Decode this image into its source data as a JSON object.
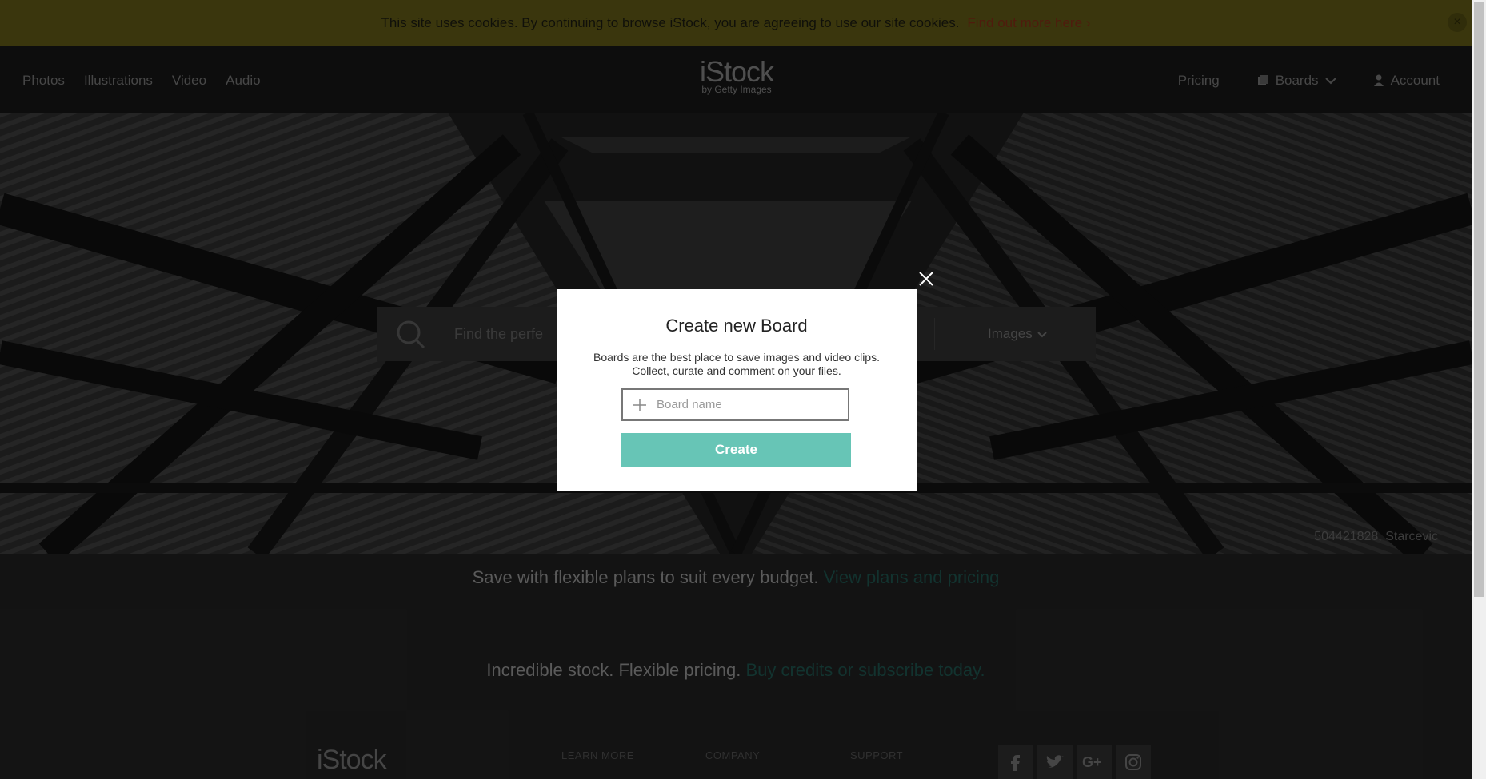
{
  "cookie_bar": {
    "message": "This site uses cookies. By continuing to browse iStock, you are agreeing to use our site cookies.",
    "link": "Find out more here ›",
    "close": "×"
  },
  "header": {
    "nav_left": [
      "Photos",
      "Illustrations",
      "Video",
      "Audio"
    ],
    "logo": {
      "main": "iStock",
      "sub": "by Getty Images"
    },
    "pricing": "Pricing",
    "boards": "Boards",
    "account": "Account"
  },
  "search": {
    "placeholder": "Find the perfect image or video",
    "visible_placeholder": "Find the perfe",
    "type": "Images"
  },
  "hero": {
    "credit": "504421828, Starcevic"
  },
  "promo": {
    "line1": "Save with flexible plans to suit every budget.",
    "link1": "View plans and pricing",
    "line2": "Incredible stock. Flexible pricing.",
    "link2": "Buy credits or subscribe today."
  },
  "footer": {
    "logo": "iStock",
    "headings": [
      "LEARN MORE",
      "COMPANY",
      "SUPPORT"
    ],
    "social": [
      "facebook-icon",
      "twitter-icon",
      "google-plus-icon",
      "instagram-icon"
    ]
  },
  "modal": {
    "title": "Create new Board",
    "description": "Boards are the best place to save images and video clips. Collect, curate and comment on your files.",
    "input_placeholder": "Board name",
    "input_value": "",
    "create_label": "Create"
  },
  "colors": {
    "accent_teal": "#67c5b6",
    "cookie_bg": "#5a5414",
    "cookie_link": "#7a2a15"
  }
}
